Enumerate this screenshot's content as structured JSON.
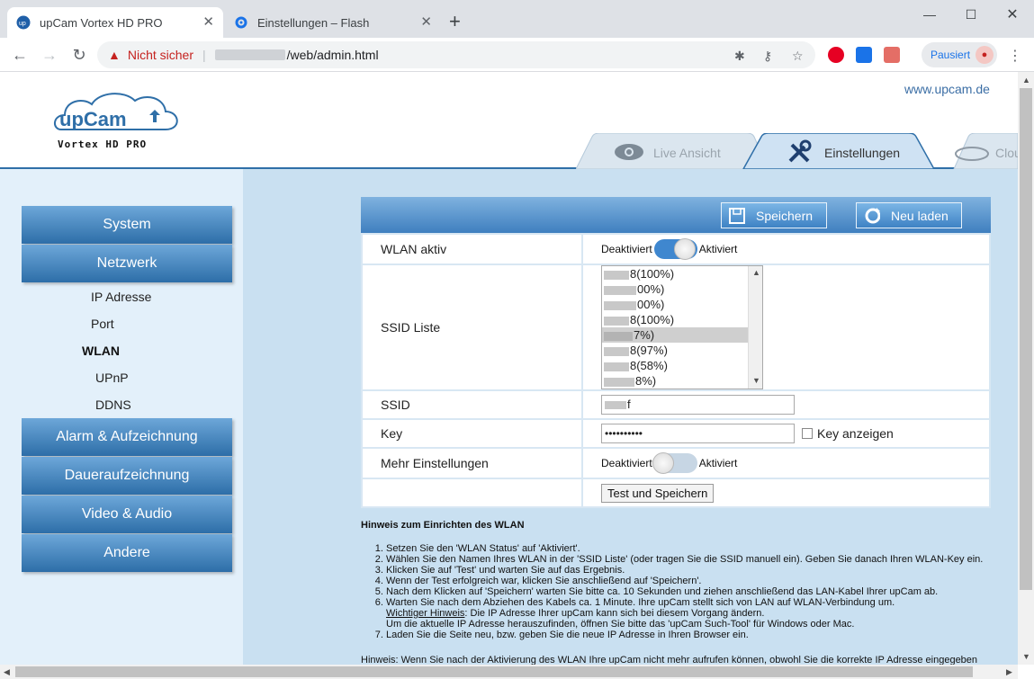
{
  "browser": {
    "tabs": [
      {
        "title": "upCam Vortex HD PRO",
        "active": true
      },
      {
        "title": "Einstellungen – Flash",
        "active": false
      }
    ],
    "address": {
      "security_label": "Nicht sicher",
      "path": "/web/admin.html"
    },
    "profile_label": "Pausiert"
  },
  "header": {
    "site_url": "www.upcam.de",
    "logo_text": "upCam",
    "logo_sub": "Vortex HD PRO",
    "tabs": [
      {
        "label": "Live Ansicht",
        "icon": "eye-icon"
      },
      {
        "label": "Einstellungen",
        "icon": "tools-icon"
      },
      {
        "label": "Clou",
        "icon": "cloud-icon"
      }
    ]
  },
  "sidebar": {
    "menu": [
      "System",
      "Netzwerk",
      "Alarm & Aufzeichnung",
      "Daueraufzeichnung",
      "Video & Audio",
      "Andere"
    ],
    "network_items": [
      "IP Adresse",
      "Port",
      "WLAN",
      "UPnP",
      "DDNS"
    ]
  },
  "panel": {
    "save_label": "Speichern",
    "reload_label": "Neu laden",
    "wlan_label": "WLAN aktiv",
    "ssid_list_label": "SSID Liste",
    "ssid_label": "SSID",
    "key_label": "Key",
    "more_label": "Mehr Einstellungen",
    "deactivated": "Deaktiviert",
    "activated": "Aktiviert",
    "show_key_label": "Key anzeigen",
    "key_value": "••••••••••",
    "ssid_value": "f",
    "test_save_label": "Test und Speichern",
    "ssid_items": [
      "8(100%)",
      "00%)",
      "00%)",
      "8(100%)",
      "7%)",
      "8(97%)",
      "8(58%)",
      "8%)"
    ],
    "selected_ssid_index": 4,
    "wlan_enabled": true,
    "more_enabled": false
  },
  "note": {
    "title": "Hinweis zum Einrichten des WLAN",
    "steps": [
      "Setzen Sie den 'WLAN Status' auf 'Aktiviert'.",
      "Wählen Sie den Namen Ihres WLAN in der 'SSID Liste' (oder tragen Sie die SSID manuell ein). Geben Sie danach Ihren WLAN-Key ein.",
      "Klicken Sie auf 'Test' und warten Sie auf das Ergebnis.",
      "Wenn der Test erfolgreich war, klicken Sie anschließend auf 'Speichern'.",
      "Nach dem Klicken auf 'Speichern' warten Sie bitte ca. 10 Sekunden und ziehen anschließend das LAN-Kabel Ihrer upCam ab.",
      "Warten Sie nach dem Abziehen des Kabels ca. 1 Minute. Ihre upCam stellt sich von LAN auf WLAN-Verbindung um.",
      "Laden Sie die Seite neu, bzw. geben Sie die neue IP Adresse in Ihren Browser ein."
    ],
    "important_label": "Wichtiger Hinweis",
    "important_text": ": Die IP Adresse Ihrer upCam kann sich bei diesem Vorgang ändern.",
    "important_text2": "Um die aktuelle IP Adresse herauszufinden, öffnen Sie bitte das 'upCam Such-Tool' für Windows oder Mac.",
    "footer_text": "Hinweis: Wenn Sie nach der Aktivierung des WLAN Ihre upCam nicht mehr aufrufen können, obwohl Sie die korrekte IP Adresse eingegeben"
  }
}
